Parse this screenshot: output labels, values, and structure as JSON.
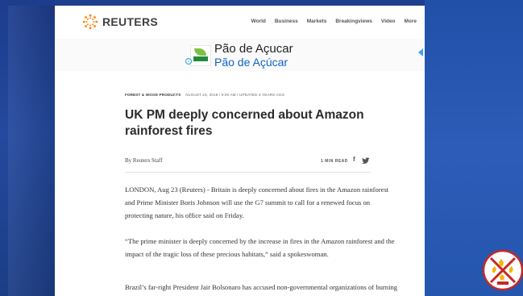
{
  "site": {
    "brand": "REUTERS",
    "nav": [
      "World",
      "Business",
      "Markets",
      "Breakingviews",
      "Video",
      "More"
    ]
  },
  "ad": {
    "title": "Pão de Açucar",
    "subtitle": "Pão de Açúcar",
    "info_glyph": "i"
  },
  "article": {
    "category": "FOREST & WOOD PRODUCTS",
    "timestamp": "AUGUST 23, 2019 / 9:00 AM / UPDATED 4 YEARS AGO",
    "headline": "UK PM deeply concerned about Amazon rainforest fires",
    "byline": "By Reuters Staff",
    "read_time": "1 MIN READ",
    "share_icons": [
      "facebook-icon",
      "twitter-icon"
    ],
    "paragraphs": [
      "LONDON, Aug 23 (Reuters) - Britain is deeply concerned about fires in the Amazon rainforest and Prime Minister Boris Johnson will use the G7 summit to call for a renewed focus on protecting nature, his office said on Friday.",
      "“The prime minister is deeply concerned by the increase in fires in the Amazon rainforest and the impact of the tragic loss of these precious habitats,” said a spokeswoman.",
      "Brazil’s far-right President Jair Bolsonaro has accused non-governmental organizations of burning down the Amazon rainforest to hurt his government, amid a"
    ]
  },
  "colors": {
    "frame_blue": "#24499e",
    "link_blue": "#0f63c8",
    "brand_orange": "#ff8000"
  }
}
